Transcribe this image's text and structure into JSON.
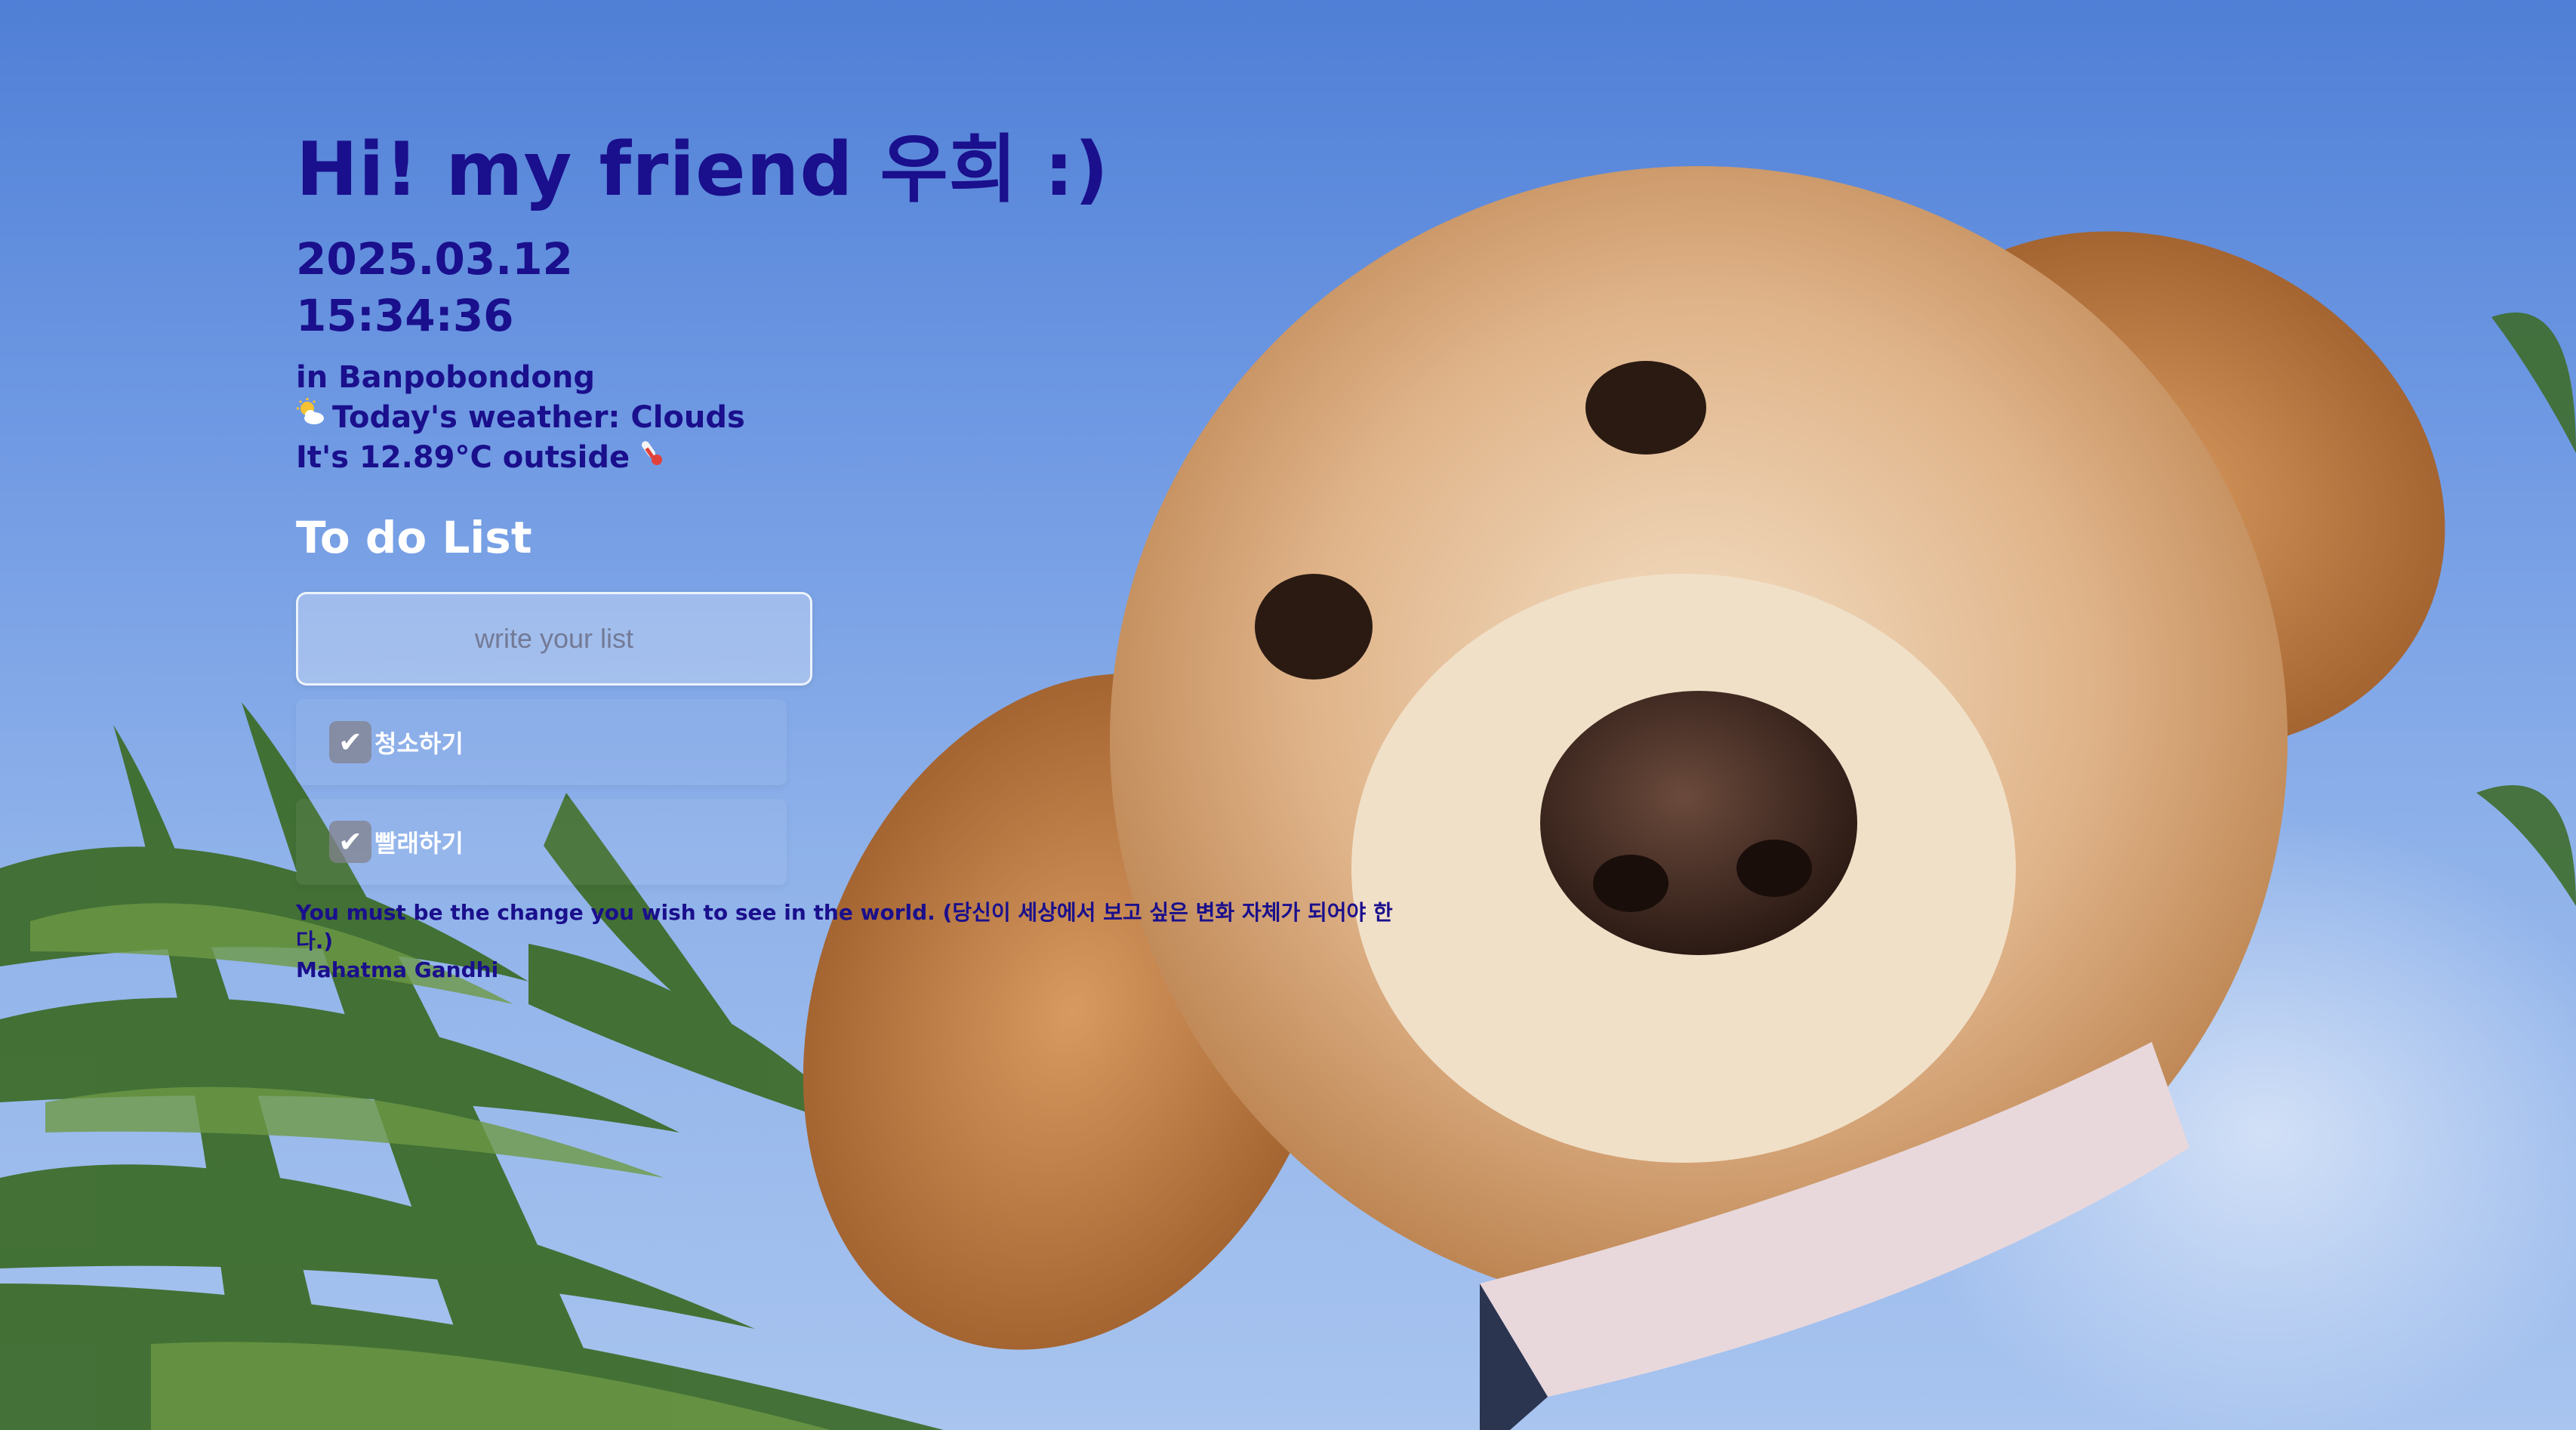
{
  "greeting": "Hi! my friend 우희 :)",
  "date": "2025.03.12",
  "time": "15:34:36",
  "location": "in Banpobondong",
  "weather": {
    "icon": "sun-behind-cloud-icon",
    "text": "Today's weather: Clouds",
    "temperature_text": "It's 12.89°C outside",
    "temperature_icon": "thermometer-icon"
  },
  "todo": {
    "title": "To do List",
    "input_placeholder": "write your list",
    "items": [
      {
        "check": "✔",
        "text": "청소하기"
      },
      {
        "check": "✔",
        "text": "빨래하기"
      }
    ]
  },
  "quote": {
    "text": "You must be the change you wish to see in the world. (당신이 세상에서 보고 싶은 변화 자체가 되어야 한다.)",
    "author": "Mahatma Gandhi"
  },
  "colors": {
    "heading": "#1a0f8c",
    "todo_title": "#ffffff"
  }
}
